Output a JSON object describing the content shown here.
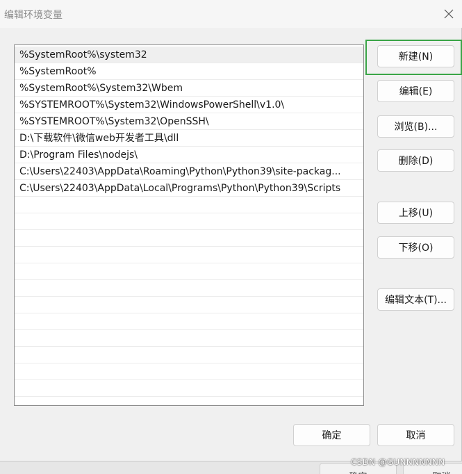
{
  "window": {
    "title": "编辑环境变量"
  },
  "list": {
    "items": [
      "%SystemRoot%\\system32",
      "%SystemRoot%",
      "%SystemRoot%\\System32\\Wbem",
      "%SYSTEMROOT%\\System32\\WindowsPowerShell\\v1.0\\",
      "%SYSTEMROOT%\\System32\\OpenSSH\\",
      "D:\\下载软件\\微信web开发者工具\\dll",
      "D:\\Program Files\\nodejs\\",
      "C:\\Users\\22403\\AppData\\Roaming\\Python\\Python39\\site-packag...",
      "C:\\Users\\22403\\AppData\\Local\\Programs\\Python\\Python39\\Scripts",
      "",
      "",
      "",
      "",
      "",
      "",
      "",
      "",
      "",
      "",
      "",
      "",
      ""
    ],
    "selected_index": 0
  },
  "buttons": {
    "new": "新建(N)",
    "edit": "编辑(E)",
    "browse": "浏览(B)...",
    "delete": "删除(D)",
    "move_up": "上移(U)",
    "move_down": "下移(O)",
    "edit_text": "编辑文本(T)...",
    "ok": "确定",
    "cancel": "取消"
  },
  "background_window": {
    "ok": "确定",
    "cancel": "取消"
  },
  "watermark": "CSDN @GUNNNNNNN",
  "colors": {
    "highlight": "#3aa547",
    "selected_row": "#efefef"
  }
}
